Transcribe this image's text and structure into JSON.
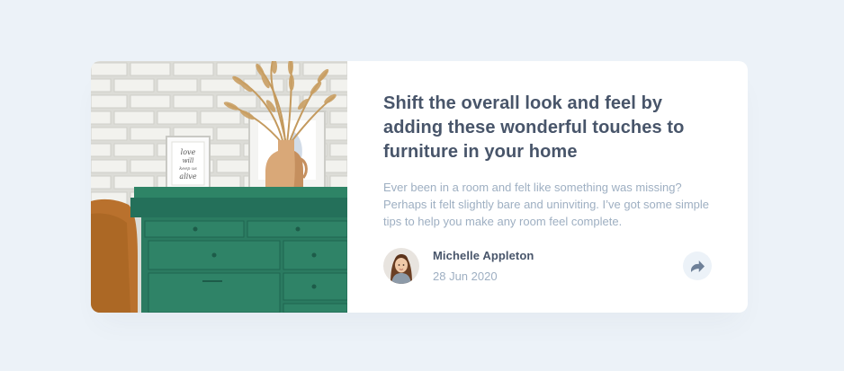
{
  "card": {
    "title": "Shift the overall look and feel by adding these wonderful touches to furniture in your home",
    "excerpt": "Ever been in a room and felt like something was missing? Perhaps it felt slightly bare and uninviting. I’ve got some simple tips to help you make any room feel complete.",
    "author": {
      "name": "Michelle Appleton",
      "date": "28 Jun 2020"
    },
    "image": {
      "frame_text": [
        "love",
        "will",
        "keep us",
        "alive"
      ]
    }
  },
  "colors": {
    "background": "#ecf2f8",
    "card": "#ffffff",
    "title": "#48556a",
    "muted": "#9eafc2",
    "dresser": "#2c7a60",
    "share_icon": "#6e8098"
  },
  "icons": {
    "share": "share-arrow-icon"
  }
}
